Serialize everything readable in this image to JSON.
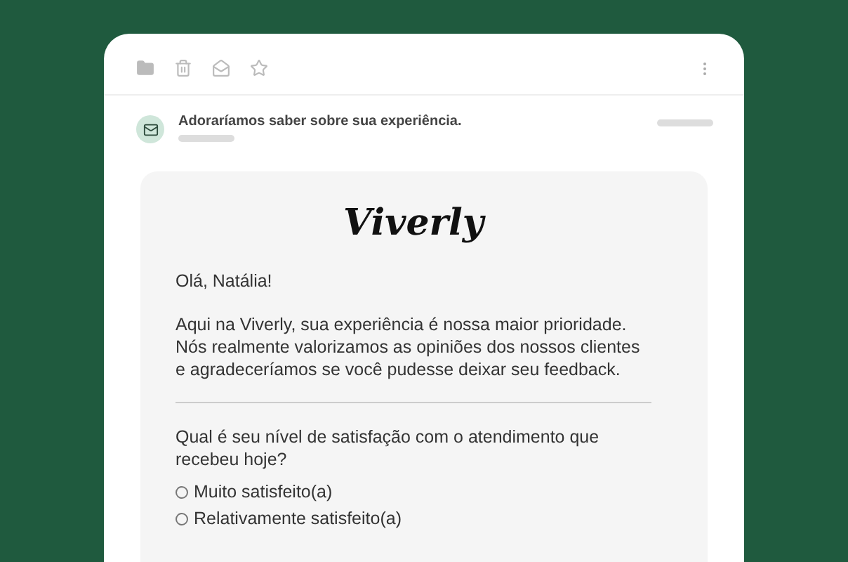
{
  "email": {
    "subject": "Adoraríamos saber sobre sua experiência."
  },
  "message": {
    "logo": "Viverly",
    "greeting": "Olá, Natália!",
    "body": "Aqui na Viverly, sua experiência é nossa maior prioridade. Nós realmente valorizamos as opiniões dos nossos clientes e agradeceríamos se você pudesse deixar seu feedback.",
    "question": "Qual é seu nível de satisfação com o atendimento que recebeu hoje?",
    "options": [
      {
        "label": "Muito satisfeito(a)",
        "selected": false
      },
      {
        "label": "Relativamente satisfeito(a)",
        "selected": false
      }
    ]
  }
}
